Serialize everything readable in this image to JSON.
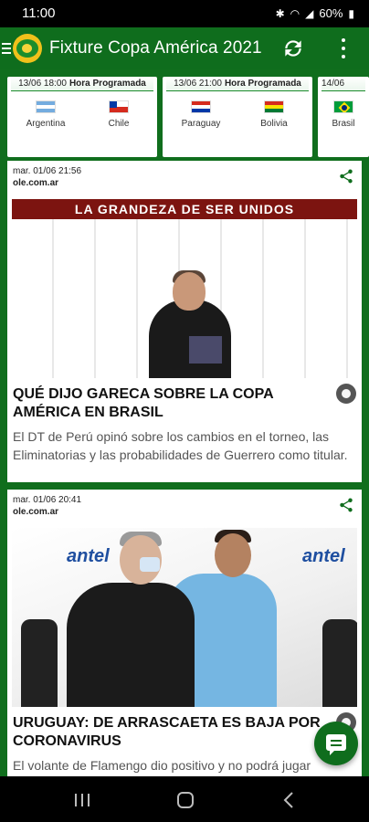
{
  "status_bar": {
    "time": "11:00",
    "battery": "60%",
    "icons": [
      "bluetooth-icon",
      "wifi-icon",
      "signal-icon",
      "battery-icon"
    ]
  },
  "app_bar": {
    "title": "Fixture Copa América 2021",
    "icons": [
      "menu-icon",
      "app-logo",
      "refresh-icon",
      "more-vert-icon"
    ]
  },
  "fixtures": [
    {
      "datetime": "13/06 18:00",
      "status": "Hora Programada",
      "home": "Argentina",
      "away": "Chile"
    },
    {
      "datetime": "13/06 21:00",
      "status": "Hora Programada",
      "home": "Paraguay",
      "away": "Bolivia"
    },
    {
      "datetime": "14/06",
      "status": "",
      "home": "Brasil",
      "away": ""
    }
  ],
  "news": [
    {
      "date": "mar. 01/06 21:56",
      "source": "ole.com.ar",
      "image_banner": "LA GRANDEZA DE SER UNIDOS",
      "title": "QUÉ DIJO GARECA SOBRE LA COPA AMÉRICA EN BRASIL",
      "summary": "El DT de Perú opinó sobre los cambios en el torneo, las Eliminatorias y las probabilidades de Guerrero como titular."
    },
    {
      "date": "mar. 01/06 20:41",
      "source": "ole.com.ar",
      "image_banner": "antel",
      "title": "URUGUAY: DE ARRASCAETA ES BAJA POR CORONAVIRUS",
      "summary": "El volante de Flamengo dio positivo y no podrá jugar"
    }
  ],
  "colors": {
    "primary": "#0f6d1d",
    "status_bar": "#000000",
    "card": "#ffffff",
    "accent_line": "#1b8c2c"
  }
}
